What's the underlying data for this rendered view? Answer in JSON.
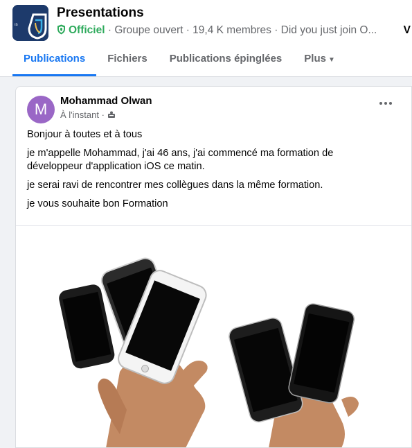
{
  "group": {
    "name": "Presentations",
    "badge": "Officiel",
    "meta": " · Groupe ouvert · 19,4 K membres · Did you just join O...",
    "meta_cut": "V"
  },
  "tabs": [
    {
      "label": "Publications",
      "active": true
    },
    {
      "label": "Fichiers",
      "active": false
    },
    {
      "label": "Publications épinglées",
      "active": false
    },
    {
      "label": "Plus",
      "active": false
    }
  ],
  "post": {
    "author": "Mohammad Olwan",
    "avatar_letter": "M",
    "time": "À l'instant · ",
    "privacy_icon": "group-audience-icon",
    "paragraphs": [
      "Bonjour à toutes et à tous",
      "je m'appelle Mohammad, j'ai 46 ans, j'ai commencé ma formation de développeur d'application iOS ce matin.",
      "je serai ravi de rencontrer mes collègues dans la même formation.",
      "je vous souhaite bon Formation"
    ]
  },
  "colors": {
    "accent": "#1877f2",
    "official": "#2eaa5c",
    "avatar": "#9a67c6",
    "logo_bg": "#1d3a6b"
  }
}
